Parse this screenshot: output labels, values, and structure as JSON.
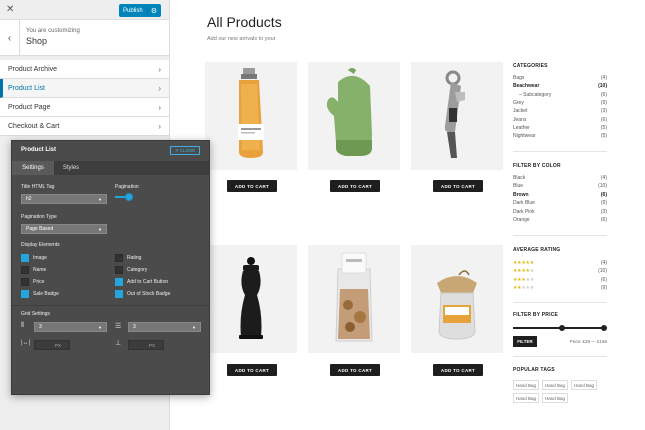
{
  "customizer": {
    "publish_label": "Publish",
    "you_are_customizing": "You are customizing",
    "site_name": "Shop",
    "items": [
      {
        "label": "Product Archive",
        "active": false
      },
      {
        "label": "Product List",
        "active": true
      },
      {
        "label": "Product Page",
        "active": false
      },
      {
        "label": "Checkout & Cart",
        "active": false
      }
    ]
  },
  "main": {
    "title": "All Products",
    "subtitle": "Add our new arrivals to your",
    "add_to_cart": "ADD TO CART",
    "products": [
      {
        "name": "pasta-jar"
      },
      {
        "name": "oven-mitt"
      },
      {
        "name": "bottle-opener"
      },
      {
        "name": "pepper-mill"
      },
      {
        "name": "cookie-bag"
      },
      {
        "name": "jam-jar"
      }
    ]
  },
  "sidebar": {
    "categories_title": "CATEGORIES",
    "categories": [
      {
        "name": "Bags",
        "count": "(4)",
        "bold": false
      },
      {
        "name": "Beachwear",
        "count": "(10)",
        "bold": true
      },
      {
        "name": "– Subcategory",
        "count": "(6)",
        "bold": false,
        "sub": true
      },
      {
        "name": "Grey",
        "count": "(9)",
        "bold": false
      },
      {
        "name": "Jacket",
        "count": "(3)",
        "bold": false
      },
      {
        "name": "Jeans",
        "count": "(6)",
        "bold": false
      },
      {
        "name": "Leather",
        "count": "(5)",
        "bold": false
      },
      {
        "name": "Nightwear",
        "count": "(5)",
        "bold": false
      }
    ],
    "color_title": "FILTER BY COLOR",
    "colors": [
      {
        "name": "Black",
        "count": "(4)",
        "bold": false
      },
      {
        "name": "Blue",
        "count": "(10)",
        "bold": false
      },
      {
        "name": "Brown",
        "count": "(6)",
        "bold": true
      },
      {
        "name": "Dark Blue",
        "count": "(9)",
        "bold": false
      },
      {
        "name": "Dark Pink",
        "count": "(3)",
        "bold": false
      },
      {
        "name": "Orange",
        "count": "(6)",
        "bold": false
      }
    ],
    "rating_title": "AVERAGE RATING",
    "ratings": [
      {
        "stars": 5,
        "count": "(4)"
      },
      {
        "stars": 4,
        "count": "(10)"
      },
      {
        "stars": 3,
        "count": "(6)"
      },
      {
        "stars": 2,
        "count": "(9)"
      }
    ],
    "price_title": "FILTER BY PRICE",
    "filter_label": "FILTER",
    "price_text": "Price: £29 — £166",
    "tags_title": "POPULAR TAGS",
    "tags": [
      "Hand Bag",
      "Hand Bag",
      "Hand Bag",
      "Hand Bag",
      "Hand Bag"
    ]
  },
  "panel": {
    "title": "Product List",
    "close_label": "✕ CLOSE",
    "tabs": [
      "Settings",
      "Styles"
    ],
    "title_tag_label": "Title HTML Tag",
    "title_tag_value": "h2",
    "pagination_label": "Pagination",
    "pagination_enabled": true,
    "pagination_type_label": "Pagination Type",
    "pagination_type_value": "Page Based",
    "display_elements_label": "Display Elements",
    "elements": [
      {
        "label": "Image",
        "checked": true
      },
      {
        "label": "Rating",
        "checked": false
      },
      {
        "label": "Name",
        "checked": false
      },
      {
        "label": "Category",
        "checked": false
      },
      {
        "label": "Price",
        "checked": false
      },
      {
        "label": "Add to Cart Button",
        "checked": true
      },
      {
        "label": "Sale Badge",
        "checked": true
      },
      {
        "label": "Out of Stock Badge",
        "checked": true
      }
    ],
    "grid_settings_label": "Grid Settings",
    "columns_value": "3",
    "rows_value": "3",
    "unit_left": "PX",
    "unit_right": "PX"
  }
}
